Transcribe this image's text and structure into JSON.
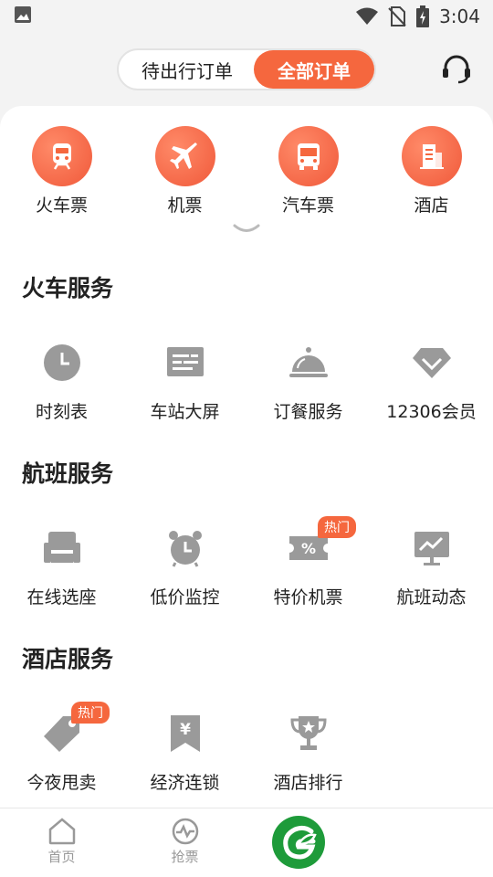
{
  "status_bar": {
    "time": "3:04"
  },
  "header": {
    "tabs": [
      {
        "label": "待出行订单",
        "active": false
      },
      {
        "label": "全部订单",
        "active": true
      }
    ]
  },
  "top_services": [
    {
      "label": "火车票",
      "icon": "train-icon"
    },
    {
      "label": "机票",
      "icon": "plane-icon"
    },
    {
      "label": "汽车票",
      "icon": "bus-icon"
    },
    {
      "label": "酒店",
      "icon": "hotel-icon"
    }
  ],
  "sections": [
    {
      "title": "火车服务",
      "items": [
        {
          "label": "时刻表",
          "icon": "clock-icon"
        },
        {
          "label": "车站大屏",
          "icon": "board-icon"
        },
        {
          "label": "订餐服务",
          "icon": "cloche-icon"
        },
        {
          "label": "12306会员",
          "icon": "diamond-icon"
        }
      ]
    },
    {
      "title": "航班服务",
      "items": [
        {
          "label": "在线选座",
          "icon": "seat-icon"
        },
        {
          "label": "低价监控",
          "icon": "alarm-icon"
        },
        {
          "label": "特价机票",
          "icon": "discount-ticket-icon",
          "badge": "热门"
        },
        {
          "label": "航班动态",
          "icon": "trend-monitor-icon"
        }
      ]
    },
    {
      "title": "酒店服务",
      "items": [
        {
          "label": "今夜甩卖",
          "icon": "tag-icon",
          "badge": "热门"
        },
        {
          "label": "经济连锁",
          "icon": "yen-bookmark-icon"
        },
        {
          "label": "酒店排行",
          "icon": "trophy-icon"
        }
      ]
    }
  ],
  "bottom_nav": [
    {
      "label": "首页",
      "icon": "home-icon"
    },
    {
      "label": "抢票",
      "icon": "pulse-icon"
    },
    {
      "label": "",
      "icon": "app-logo-icon"
    }
  ],
  "colors": {
    "accent": "#f5673e",
    "icon_gray": "#9a9a9a",
    "logo_green": "#1e9b3a"
  }
}
